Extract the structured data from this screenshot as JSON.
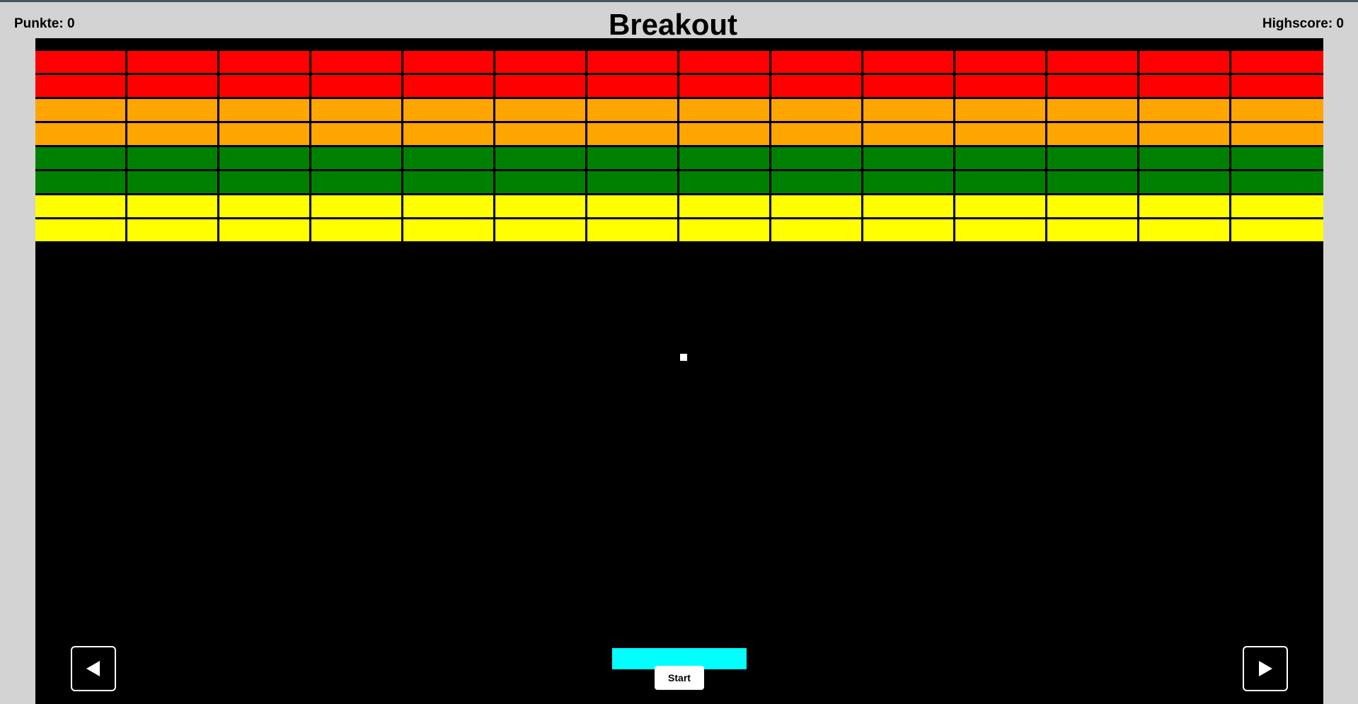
{
  "header": {
    "title": "Breakout",
    "score_text": "Punkte: 0",
    "highscore_text": "Highscore: 0"
  },
  "game": {
    "brick_columns": 14,
    "brick_rows": [
      {
        "color": "#ff0000"
      },
      {
        "color": "#ff0000"
      },
      {
        "color": "#ffa500"
      },
      {
        "color": "#ffa500"
      },
      {
        "color": "#008000"
      },
      {
        "color": "#008000"
      },
      {
        "color": "#ffff00"
      },
      {
        "color": "#ffff00"
      }
    ],
    "background_color": "#000000",
    "ball_color": "#ffffff",
    "paddle_color": "#00ffff"
  },
  "controls": {
    "start_label": "Start",
    "left_icon": "left-triangle-icon",
    "right_icon": "right-triangle-icon"
  }
}
